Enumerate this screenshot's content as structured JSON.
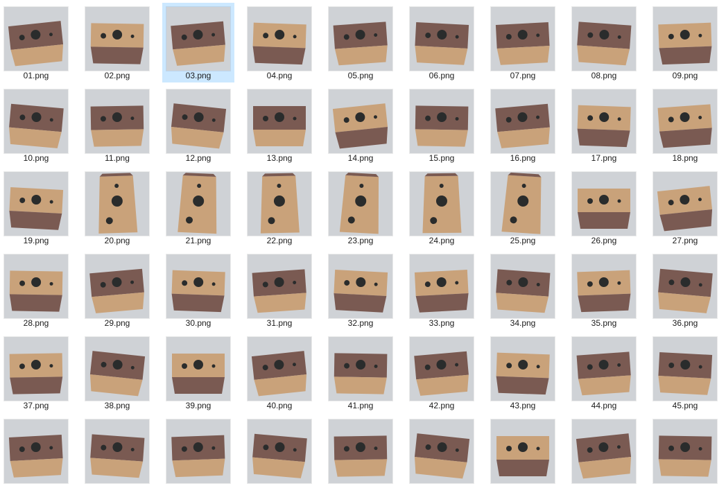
{
  "files": [
    {
      "name": "01.png",
      "view": "dark-top",
      "selected": false
    },
    {
      "name": "02.png",
      "view": "light-top",
      "selected": false
    },
    {
      "name": "03.png",
      "view": "dark-top",
      "selected": true
    },
    {
      "name": "04.png",
      "view": "light-top",
      "selected": false
    },
    {
      "name": "05.png",
      "view": "dark-top",
      "selected": false
    },
    {
      "name": "06.png",
      "view": "dark-top",
      "selected": false
    },
    {
      "name": "07.png",
      "view": "dark-top",
      "selected": false
    },
    {
      "name": "08.png",
      "view": "dark-top",
      "selected": false
    },
    {
      "name": "09.png",
      "view": "light-top",
      "selected": false
    },
    {
      "name": "10.png",
      "view": "dark-top",
      "selected": false
    },
    {
      "name": "11.png",
      "view": "dark-top",
      "selected": false
    },
    {
      "name": "12.png",
      "view": "dark-top",
      "selected": false
    },
    {
      "name": "13.png",
      "view": "dark-top",
      "selected": false
    },
    {
      "name": "14.png",
      "view": "light-top",
      "selected": false
    },
    {
      "name": "15.png",
      "view": "dark-top",
      "selected": false
    },
    {
      "name": "16.png",
      "view": "dark-top",
      "selected": false
    },
    {
      "name": "17.png",
      "view": "light-top",
      "selected": false
    },
    {
      "name": "18.png",
      "view": "light-top",
      "selected": false
    },
    {
      "name": "19.png",
      "view": "light-top",
      "selected": false
    },
    {
      "name": "20.png",
      "view": "tall",
      "selected": false
    },
    {
      "name": "21.png",
      "view": "tall",
      "selected": false
    },
    {
      "name": "22.png",
      "view": "tall",
      "selected": false
    },
    {
      "name": "23.png",
      "view": "tall",
      "selected": false
    },
    {
      "name": "24.png",
      "view": "tall",
      "selected": false
    },
    {
      "name": "25.png",
      "view": "tall",
      "selected": false
    },
    {
      "name": "26.png",
      "view": "light-top",
      "selected": false
    },
    {
      "name": "27.png",
      "view": "light-top",
      "selected": false
    },
    {
      "name": "28.png",
      "view": "light-top",
      "selected": false
    },
    {
      "name": "29.png",
      "view": "dark-top",
      "selected": false
    },
    {
      "name": "30.png",
      "view": "light-top",
      "selected": false
    },
    {
      "name": "31.png",
      "view": "dark-top",
      "selected": false
    },
    {
      "name": "32.png",
      "view": "light-top",
      "selected": false
    },
    {
      "name": "33.png",
      "view": "light-top",
      "selected": false
    },
    {
      "name": "34.png",
      "view": "dark-top",
      "selected": false
    },
    {
      "name": "35.png",
      "view": "light-top",
      "selected": false
    },
    {
      "name": "36.png",
      "view": "dark-top",
      "selected": false
    },
    {
      "name": "37.png",
      "view": "light-top",
      "selected": false
    },
    {
      "name": "38.png",
      "view": "dark-top",
      "selected": false
    },
    {
      "name": "39.png",
      "view": "light-top",
      "selected": false
    },
    {
      "name": "40.png",
      "view": "dark-top",
      "selected": false
    },
    {
      "name": "41.png",
      "view": "dark-top",
      "selected": false
    },
    {
      "name": "42.png",
      "view": "dark-top",
      "selected": false
    },
    {
      "name": "43.png",
      "view": "light-top",
      "selected": false
    },
    {
      "name": "44.png",
      "view": "dark-top",
      "selected": false
    },
    {
      "name": "45.png",
      "view": "dark-top",
      "selected": false
    },
    {
      "name": "",
      "view": "dark-top",
      "selected": false
    },
    {
      "name": "",
      "view": "dark-top",
      "selected": false
    },
    {
      "name": "",
      "view": "dark-top",
      "selected": false
    },
    {
      "name": "",
      "view": "dark-top",
      "selected": false
    },
    {
      "name": "",
      "view": "dark-top",
      "selected": false
    },
    {
      "name": "",
      "view": "dark-top",
      "selected": false
    },
    {
      "name": "",
      "view": "light-top",
      "selected": false
    },
    {
      "name": "",
      "view": "dark-top",
      "selected": false
    },
    {
      "name": "",
      "view": "dark-top",
      "selected": false
    }
  ],
  "colors": {
    "selection": "#cce8ff",
    "background": "#cfd2d6",
    "box_dark": "#7a5a52",
    "box_light": "#c9a27a",
    "dot": "#2a2c2c"
  }
}
